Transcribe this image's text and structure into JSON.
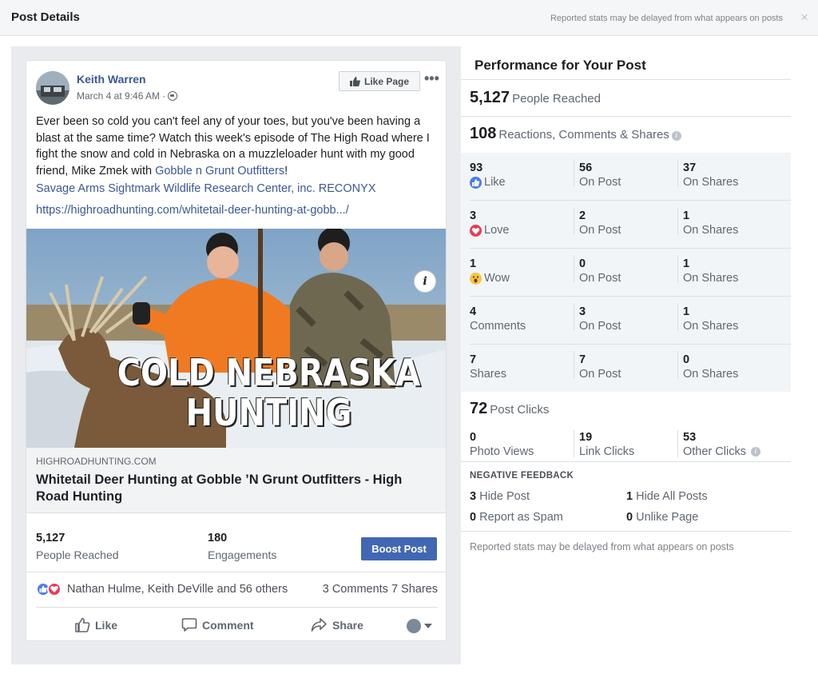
{
  "modal": {
    "title": "Post Details",
    "note": "Reported stats may be delayed from what appears on posts",
    "close": "×"
  },
  "post": {
    "author": "Keith Warren",
    "time": "March 4 at 9:46 AM ·",
    "like_page_label": "Like Page",
    "more": "•••",
    "text_main": "Ever been so cold you can't feel any of your toes, but you've been having a blast at the same time? Watch this week's episode of The High Road where I fight the snow and cold in Nebraska on a muzzleloader hunt with my good friend, Mike Zmek with ",
    "text_link": "Gobble n Grunt Outfitters",
    "text_end": "!",
    "tags": "Savage Arms Sightmark Wildlife Research Center, inc. RECONYX",
    "url": "https://highroadhunting.com/whitetail-deer-hunting-at-gobb.../",
    "image_title_line1": "COLD NEBRASKA",
    "image_title_line2": "HUNTING",
    "info_btn": "i",
    "link_domain": "HIGHROADHUNTING.COM",
    "link_title": "Whitetail Deer Hunting at Gobble ’N Grunt Outfitters - High Road Hunting"
  },
  "post_stats": {
    "reached_num": "5,127",
    "reached_label": "People Reached",
    "engagements_num": "180",
    "engagements_label": "Engagements",
    "boost_label": "Boost Post"
  },
  "reactions": {
    "names": "Nathan Hulme, Keith DeVille and 56 others",
    "counts": "3 Comments  7 Shares"
  },
  "actions": {
    "like": "Like",
    "comment": "Comment",
    "share": "Share"
  },
  "performance": {
    "title": "Performance for Your Post",
    "people_reached_num": "5,127",
    "people_reached_label": "People Reached",
    "rcs_num": "108",
    "rcs_label": "Reactions, Comments & Shares",
    "rows": [
      {
        "a_num": "93",
        "a_lbl": "Like",
        "a_icon": "like",
        "b_num": "56",
        "b_lbl": "On Post",
        "c_num": "37",
        "c_lbl": "On Shares"
      },
      {
        "a_num": "3",
        "a_lbl": "Love",
        "a_icon": "love",
        "b_num": "2",
        "b_lbl": "On Post",
        "c_num": "1",
        "c_lbl": "On Shares"
      },
      {
        "a_num": "1",
        "a_lbl": "Wow",
        "a_icon": "wow",
        "b_num": "0",
        "b_lbl": "On Post",
        "c_num": "1",
        "c_lbl": "On Shares"
      },
      {
        "a_num": "4",
        "a_lbl": "Comments",
        "a_icon": "",
        "b_num": "3",
        "b_lbl": "On Post",
        "c_num": "1",
        "c_lbl": "On Shares"
      },
      {
        "a_num": "7",
        "a_lbl": "Shares",
        "a_icon": "",
        "b_num": "7",
        "b_lbl": "On Post",
        "c_num": "0",
        "c_lbl": "On Shares"
      }
    ],
    "post_clicks_num": "72",
    "post_clicks_label": "Post Clicks",
    "photo_views_num": "0",
    "photo_views_label": "Photo Views",
    "link_clicks_num": "19",
    "link_clicks_label": "Link Clicks",
    "other_clicks_num": "53",
    "other_clicks_label": "Other Clicks",
    "negative_title": "NEGATIVE FEEDBACK",
    "hide_post_num": "3",
    "hide_post_label": "Hide Post",
    "hide_all_num": "1",
    "hide_all_label": "Hide All Posts",
    "spam_num": "0",
    "spam_label": "Report as Spam",
    "unlike_num": "0",
    "unlike_label": "Unlike Page",
    "footer_note": "Reported stats may be delayed from what appears on posts"
  }
}
